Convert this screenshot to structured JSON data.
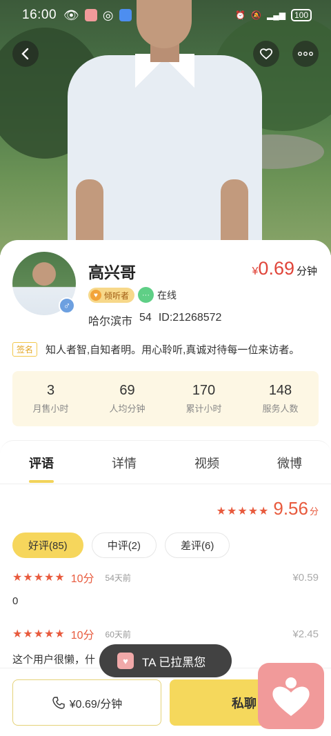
{
  "status_bar": {
    "time": "16:00",
    "battery": "100"
  },
  "profile": {
    "name": "高兴哥",
    "price_currency": "¥",
    "price_value": "0.69",
    "price_unit": "分钟",
    "tag_listener": "倾听者",
    "online_text": "在线",
    "city": "哈尔滨市",
    "age": "54",
    "id_text": "ID:21268572",
    "signature_label": "签名",
    "signature": "知人者智,自知者明。用心聆听,真诚对待每一位来访者。"
  },
  "stats": [
    {
      "value": "3",
      "label": "月售小时"
    },
    {
      "value": "69",
      "label": "人均分钟"
    },
    {
      "value": "170",
      "label": "累计小时"
    },
    {
      "value": "148",
      "label": "服务人数"
    }
  ],
  "tabs": [
    "评语",
    "详情",
    "视频",
    "微博"
  ],
  "rating": {
    "stars": "★★★★★",
    "score": "9.56",
    "unit": "分"
  },
  "filters": [
    "好评(85)",
    "中评(2)",
    "差评(6)"
  ],
  "reviews": [
    {
      "stars": "★★★★★",
      "points": "10分",
      "ago": "54天前",
      "amount": "¥0.59",
      "text": "0"
    },
    {
      "stars": "★★★★★",
      "points": "10分",
      "ago": "60天前",
      "amount": "¥2.45",
      "text": "这个用户很懒，什"
    }
  ],
  "toast": {
    "text": "TA 已拉黑您",
    "icon": "heart-app-icon"
  },
  "bottom_bar": {
    "call_label": "¥0.69/分钟",
    "chat_label": "私聊"
  },
  "colors": {
    "accent_yellow": "#f5d85c",
    "price_red": "#e0453a",
    "star_red": "#e85a3d"
  }
}
